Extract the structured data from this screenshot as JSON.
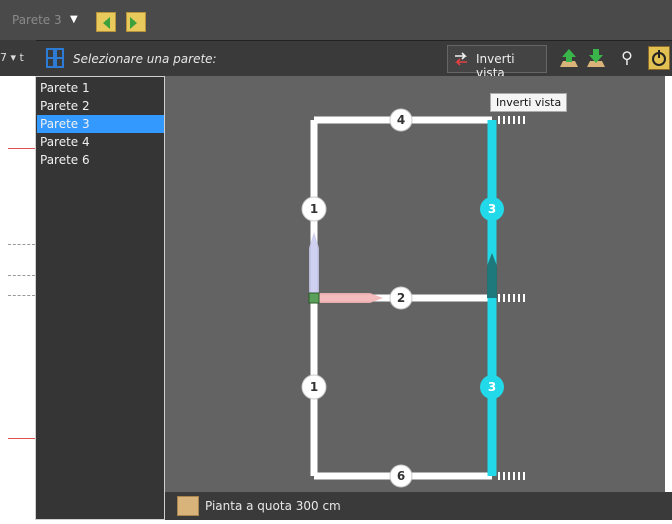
{
  "toolbar": {
    "wall_select_value": "Parete 3",
    "wall_select_prompt": "Selezionare una parete:",
    "invert_view_label": "Inverti vista",
    "left_sliver_text": "7 ▾ t"
  },
  "wall_list": {
    "items": [
      "Parete 1",
      "Parete 2",
      "Parete 3",
      "Parete 4",
      "Parete 6"
    ],
    "selected_index": 2
  },
  "tooltip": {
    "text": "Inverti vista"
  },
  "plan": {
    "wall_labels": [
      "4",
      "1",
      "3",
      "2",
      "1",
      "3",
      "6"
    ],
    "highlight_color": "#21d9e8",
    "wall_color": "#ffffff"
  },
  "status": {
    "plan_label": "Pianta a quota  300 cm"
  },
  "colors": {
    "accent_blue": "#3399ff",
    "toolbar_dark": "#3a3a3a",
    "canvas_gray": "#636363"
  }
}
